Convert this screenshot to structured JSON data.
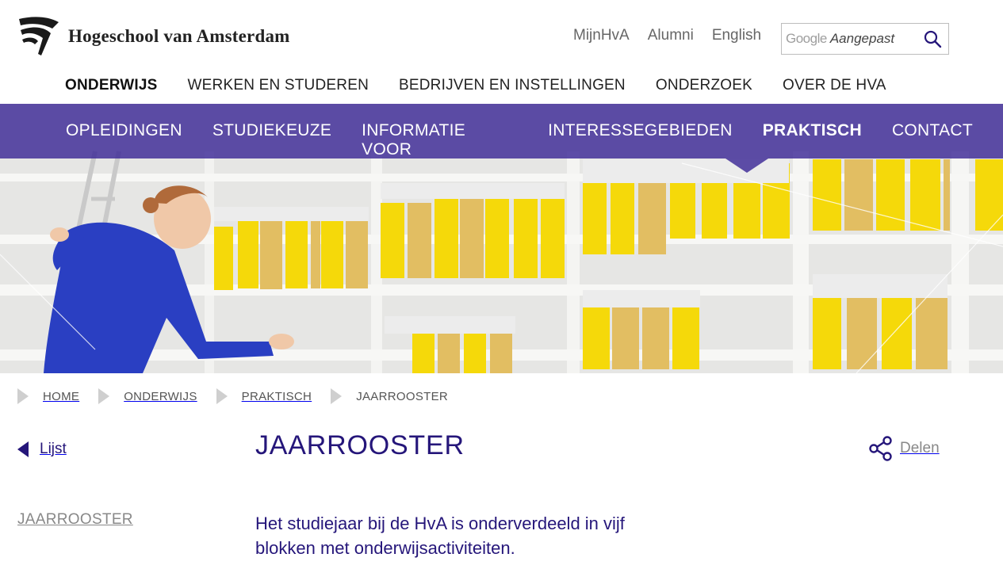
{
  "brand": {
    "name": "Hogeschool van Amsterdam"
  },
  "utility_links": [
    "MijnHvA",
    "Alumni",
    "English"
  ],
  "search": {
    "provider": "Google",
    "placeholder": "Aangepast",
    "icon": "search-icon"
  },
  "main_nav": {
    "items": [
      "ONDERWIJS",
      "WERKEN EN STUDEREN",
      "BEDRIJVEN EN INSTELLINGEN",
      "ONDERZOEK",
      "OVER DE HVA"
    ],
    "active": "ONDERWIJS"
  },
  "sub_nav": {
    "items": [
      "OPLEIDINGEN",
      "STUDIEKEUZE",
      "INFORMATIE VOOR",
      "INTERESSEGEBIEDEN",
      "PRAKTISCH",
      "CONTACT"
    ],
    "active": "PRAKTISCH"
  },
  "breadcrumb": [
    "HOME",
    "ONDERWIJS",
    "PRAKTISCH",
    "JAARROOSTER"
  ],
  "page": {
    "back_label": "Lijst",
    "title": "JAARROOSTER",
    "share_label": "Delen",
    "side_item": "JAARROOSTER",
    "intro": "Het studiejaar bij de HvA is onderverdeeld in vijf blokken met onderwijsactiviteiten."
  },
  "colors": {
    "brand_purple": "#25167a",
    "nav_overlay": "#3c2896",
    "accent_yellow": "#f5d90a"
  }
}
